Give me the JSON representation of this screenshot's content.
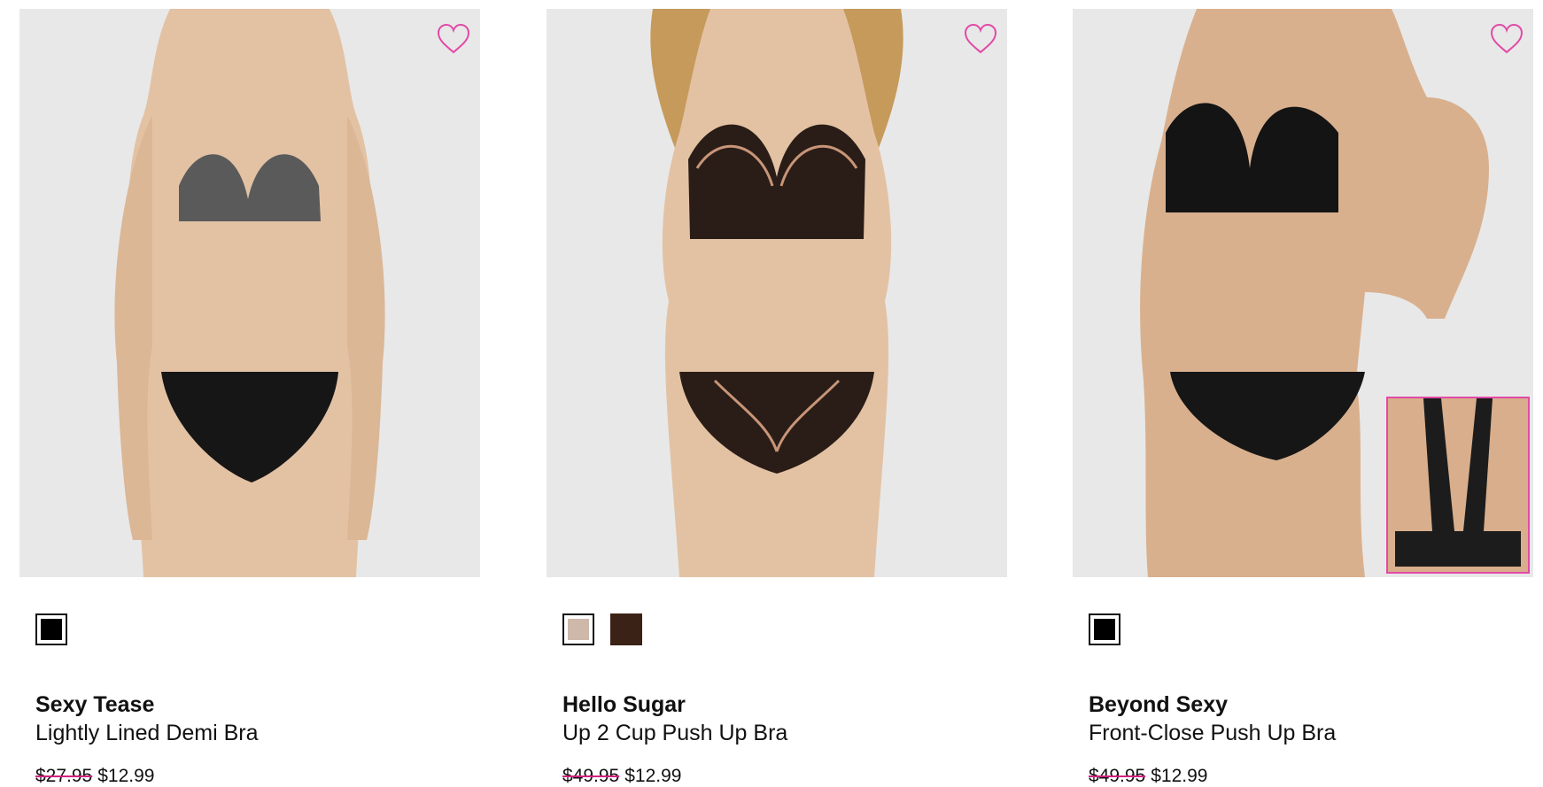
{
  "colors": {
    "accent_pink": "#e24aa6",
    "photo_bg": "#e8e8e8",
    "text": "#111111"
  },
  "products": [
    {
      "brand": "Sexy Tease",
      "name": "Lightly Lined Demi Bra",
      "original_price": "$27.95",
      "sale_price": "$12.99",
      "swatches": [
        {
          "color": "#000000",
          "selected": true
        }
      ],
      "bra_color": "#5a5a5a",
      "panty_color": "#161616",
      "has_inset": false
    },
    {
      "brand": "Hello Sugar",
      "name": "Up 2 Cup Push Up Bra",
      "original_price": "$49.95",
      "sale_price": "$12.99",
      "swatches": [
        {
          "color": "#cdb8aa",
          "selected": true
        },
        {
          "color": "#3a2216",
          "selected": false
        }
      ],
      "bra_color": "#2a1d17",
      "panty_color": "#2a1d17",
      "has_inset": false
    },
    {
      "brand": "Beyond Sexy",
      "name": "Front-Close Push Up Bra",
      "original_price": "$49.95",
      "sale_price": "$12.99",
      "swatches": [
        {
          "color": "#000000",
          "selected": true
        }
      ],
      "bra_color": "#141414",
      "panty_color": "#161616",
      "has_inset": true
    }
  ]
}
